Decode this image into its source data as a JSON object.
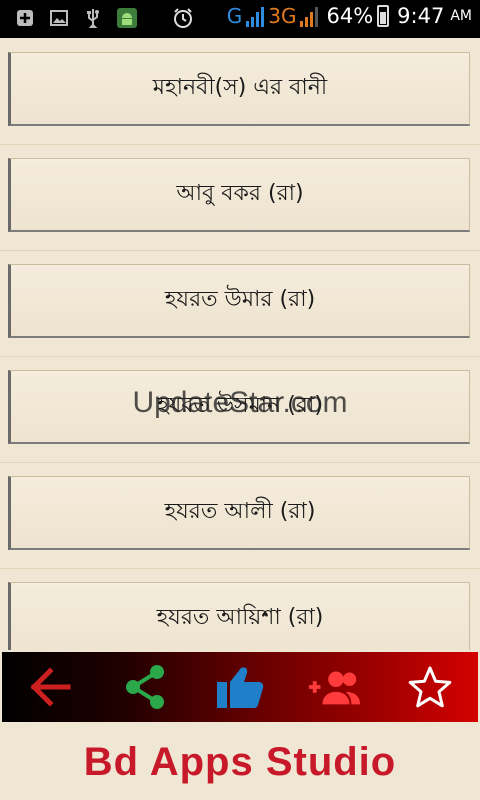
{
  "statusbar": {
    "icons": [
      "add-icon",
      "image-icon",
      "usb-icon",
      "android-icon",
      "alarm-icon"
    ],
    "network_g": "G",
    "network_3g": "3G",
    "battery_percent": "64%",
    "battery_level": 0.64,
    "time": "9:47",
    "ampm": "AM"
  },
  "items": [
    {
      "label": "মহানবী(স) এর বানী"
    },
    {
      "label": "আবু বকর (রা)"
    },
    {
      "label": "হযরত উমার (রা)"
    },
    {
      "label": "হযরত উসমান (রা)"
    },
    {
      "label": "হযরত আলী (রা)"
    },
    {
      "label": "হযরত আয়িশা (রা)"
    }
  ],
  "watermark": "UpdateStar.com",
  "bottombar": {
    "buttons": [
      "back-arrow-icon",
      "share-icon",
      "thumbs-up-icon",
      "add-group-icon",
      "star-icon"
    ],
    "colors": {
      "back": "#cc1f1f",
      "share": "#2aa84a",
      "like": "#1f7fc8",
      "add": "#ff3b3b",
      "star": "#ffffff"
    }
  },
  "footer": {
    "brand": "Bd Apps Studio",
    "color": "#c8192a"
  }
}
